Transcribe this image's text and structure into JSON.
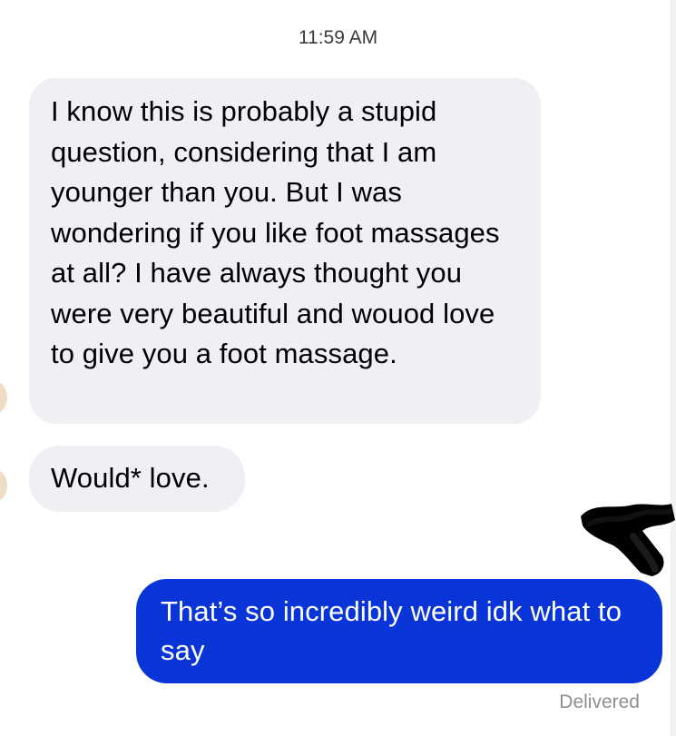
{
  "conversation": {
    "timestamp": "11:59 AM",
    "messages": [
      {
        "sender": "them",
        "text": "I know this is probably a stupid question, considering that I am younger than you. But I was wondering if you like foot massages at all? I have always thought you were very beautiful and wouod love to give you a foot massage."
      },
      {
        "sender": "them",
        "text": "Would* love."
      },
      {
        "sender": "me",
        "text": "That’s so incredibly weird idk what to say"
      }
    ],
    "delivery_status": "Delivered"
  },
  "colors": {
    "incoming_bubble": "#efeff4",
    "outgoing_bubble": "#0834d8",
    "outgoing_text": "#ffffff",
    "status_text": "#8e8e93",
    "redaction": "#000000"
  }
}
